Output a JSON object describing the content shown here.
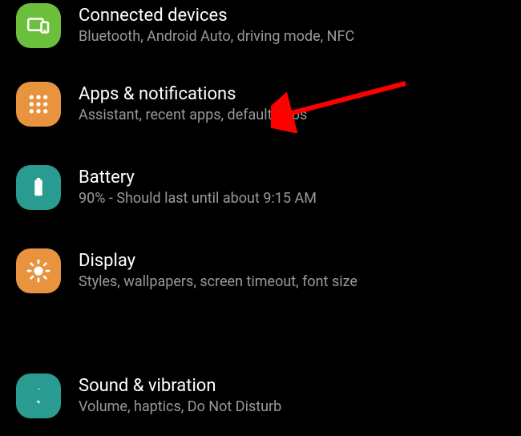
{
  "items": [
    {
      "id": "connected-devices",
      "title": "Connected devices",
      "subtitle": "Bluetooth, Android Auto, driving mode, NFC",
      "icon_bg": "#6bbf3a",
      "icon": "devices"
    },
    {
      "id": "apps-notifications",
      "title": "Apps & notifications",
      "subtitle": "Assistant, recent apps, default apps",
      "icon_bg": "#e8933e",
      "icon": "apps-grid"
    },
    {
      "id": "battery",
      "title": "Battery",
      "subtitle": "90% - Should last until about 9:15 AM",
      "icon_bg": "#299b91",
      "icon": "battery"
    },
    {
      "id": "display",
      "title": "Display",
      "subtitle": "Styles, wallpapers, screen timeout, font size",
      "icon_bg": "#e8933e",
      "icon": "brightness"
    },
    {
      "id": "sound-vibration",
      "title": "Sound & vibration",
      "subtitle": "Volume, haptics, Do Not Disturb",
      "icon_bg": "#299b91",
      "icon": "sound"
    }
  ],
  "annotation": {
    "type": "arrow",
    "color": "#ff0000",
    "points_to": "apps-notifications"
  }
}
